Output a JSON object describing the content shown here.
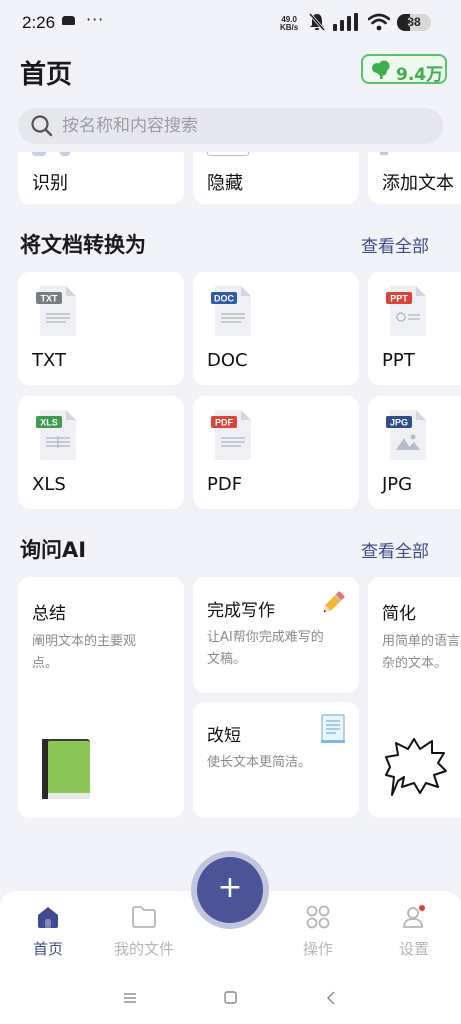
{
  "status_bar": {
    "time": "2:26",
    "dots": "···",
    "net_speed_value": "49.0",
    "net_speed_unit": "KB/s",
    "battery_level": "38",
    "battery_fill_fraction": 0.38
  },
  "header": {
    "title": "首页",
    "points": "9.4万"
  },
  "search": {
    "placeholder": "按名称和内容搜索"
  },
  "top_tools": [
    {
      "label": "识别"
    },
    {
      "label": "隐藏"
    },
    {
      "label": "添加文本"
    }
  ],
  "convert": {
    "title": "将文档转换为",
    "view_all": "查看全部",
    "items": [
      {
        "label": "TXT",
        "tag": "TXT",
        "color": "#7a7c84"
      },
      {
        "label": "DOC",
        "tag": "DOC",
        "color": "#2f5aa8"
      },
      {
        "label": "PPT",
        "tag": "PPT",
        "color": "#d9453b"
      },
      {
        "label": "XLS",
        "tag": "XLS",
        "color": "#3e9a4e"
      },
      {
        "label": "PDF",
        "tag": "PDF",
        "color": "#d9453b"
      },
      {
        "label": "JPG",
        "tag": "JPG",
        "color": "#2f4c8e"
      }
    ]
  },
  "ai": {
    "title": "询问AI",
    "view_all": "查看全部",
    "summary": {
      "title": "总结",
      "desc1": "阐明文本的主要观",
      "desc2": "点。"
    },
    "write": {
      "title": "完成写作",
      "desc1": "让AI帮你完成难写的",
      "desc2": "文稿。"
    },
    "shorten": {
      "title": "改短",
      "desc1": "使长文本更简洁。"
    },
    "simplify": {
      "title": "简化",
      "desc1": "用简单的语言来解释复",
      "desc2": "杂的文本。"
    }
  },
  "fab": {
    "label": "+"
  },
  "nav": {
    "home": "首页",
    "files": "我的文件",
    "actions": "操作",
    "settings": "设置"
  },
  "colors": {
    "accent": "#4a5497",
    "points_green": "#3fae4e",
    "background": "#f2f3f8"
  }
}
